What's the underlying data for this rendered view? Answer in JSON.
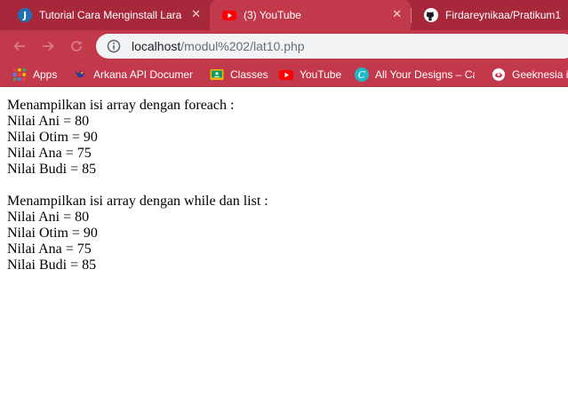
{
  "browser": {
    "tabs": [
      {
        "title": "Tutorial Cara Menginstall Larav",
        "icon": "j-badge-icon",
        "active": false
      },
      {
        "title": "(3) YouTube",
        "icon": "youtube-icon",
        "active": true
      },
      {
        "title": "Firdareynikaa/Pratikum1",
        "icon": "github-icon",
        "active": false
      }
    ],
    "close_glyph": "✕",
    "address": {
      "host": "localhost",
      "path": "/modul%202/lat10.php"
    },
    "bookmarks": [
      {
        "label": "Apps",
        "icon": "apps-grid-icon"
      },
      {
        "label": "Arkana API Documen",
        "icon": "bird-icon"
      },
      {
        "label": "Classes",
        "icon": "classroom-icon"
      },
      {
        "label": "YouTube",
        "icon": "youtube-icon"
      },
      {
        "label": "All Your Designs – Ca",
        "icon": "canva-icon"
      },
      {
        "label": "Geeknesia is",
        "icon": "geeknesia-icon"
      }
    ],
    "colors": {
      "tab_strip": "#a7283a",
      "toolbar": "#c1394b",
      "omnibox": "#f1f3f4"
    }
  },
  "page": {
    "foreach": {
      "heading": "Menampilkan isi array dengan foreach :",
      "lines": [
        "Nilai Ani = 80",
        "Nilai Otim = 90",
        "Nilai Ana = 75",
        "Nilai Budi = 85"
      ]
    },
    "while_list": {
      "heading": "Menampilkan isi array dengan while dan list :",
      "lines": [
        "Nilai Ani = 80",
        "Nilai Otim = 90",
        "Nilai Ana = 75",
        "Nilai Budi = 85"
      ]
    }
  }
}
